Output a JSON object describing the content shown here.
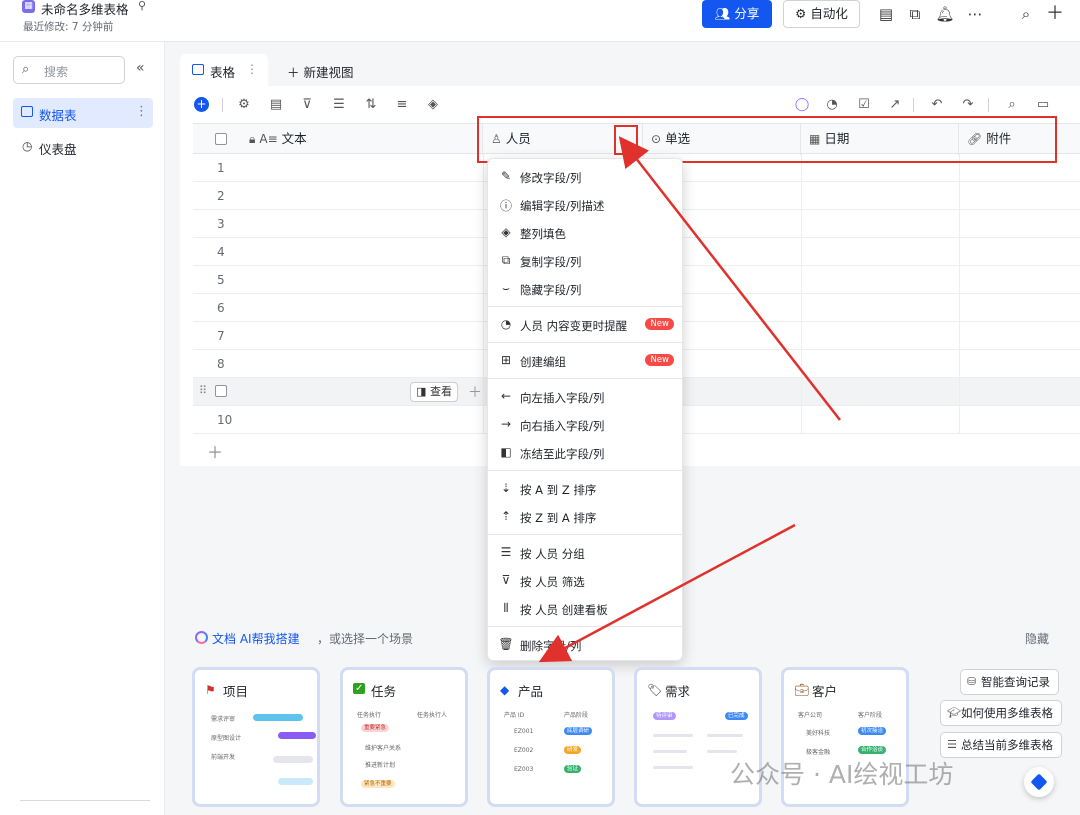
{
  "header": {
    "doc_title": "未命名多维表格",
    "last_modified": "最近修改: 7 分钟前",
    "share_label": "分享",
    "automation_label": "自动化"
  },
  "sidebar": {
    "search_placeholder": "搜索",
    "items": [
      {
        "label": "数据表",
        "active": true
      },
      {
        "label": "仪表盘",
        "active": false
      }
    ]
  },
  "views": {
    "active_tab": "表格",
    "new_view_label": "新建视图"
  },
  "table": {
    "columns": [
      {
        "label": "文本",
        "icon": "text-icon"
      },
      {
        "label": "人员",
        "icon": "person-icon"
      },
      {
        "label": "单选",
        "icon": "single-select-icon"
      },
      {
        "label": "日期",
        "icon": "calendar-icon"
      },
      {
        "label": "附件",
        "icon": "attachment-icon"
      }
    ],
    "row_numbers": [
      "1",
      "2",
      "3",
      "4",
      "5",
      "6",
      "7",
      "8",
      "",
      "10"
    ],
    "row_view_button": "查看"
  },
  "context_menu": {
    "items": [
      {
        "label": "修改字段/列",
        "icon": "pencil-icon"
      },
      {
        "label": "编辑字段/列描述",
        "icon": "info-icon"
      },
      {
        "label": "整列填色",
        "icon": "fill-icon"
      },
      {
        "label": "复制字段/列",
        "icon": "copy-icon"
      },
      {
        "label": "隐藏字段/列",
        "icon": "hide-icon"
      },
      {
        "label": "人员 内容变更时提醒",
        "icon": "reminder-icon",
        "badge": "New"
      },
      {
        "label": "创建编组",
        "icon": "group-icon",
        "badge": "New"
      },
      {
        "label": "向左插入字段/列",
        "icon": "arrow-left-icon"
      },
      {
        "label": "向右插入字段/列",
        "icon": "arrow-right-icon"
      },
      {
        "label": "冻结至此字段/列",
        "icon": "freeze-icon"
      },
      {
        "label": "按 A 到 Z 排序",
        "icon": "sort-asc-icon"
      },
      {
        "label": "按 Z 到 A 排序",
        "icon": "sort-desc-icon"
      },
      {
        "label": "按 人员 分组",
        "icon": "group-by-icon"
      },
      {
        "label": "按 人员 筛选",
        "icon": "filter-icon"
      },
      {
        "label": "按 人员 创建看板",
        "icon": "kanban-icon"
      },
      {
        "label": "删除字段/列",
        "icon": "trash-icon"
      }
    ]
  },
  "ai_banner": {
    "link": "文档 AI帮我搭建",
    "subtitle": "，或选择一个场景",
    "hide": "隐藏"
  },
  "scenarios": [
    {
      "title": "项目",
      "icon": "flag-icon"
    },
    {
      "title": "任务",
      "icon": "check-icon"
    },
    {
      "title": "产品",
      "icon": "diamond-icon"
    },
    {
      "title": "需求",
      "icon": "tag-icon"
    },
    {
      "title": "客户",
      "icon": "briefcase-icon"
    }
  ],
  "side_actions": [
    "智能查询记录",
    "如何使用多维表格",
    "总结当前多维表格"
  ],
  "preview_text": {
    "task_headers": [
      "任务执行",
      "任务执行人"
    ],
    "task_rows": [
      "维护客户关系",
      "推进新计划"
    ],
    "task_badges": [
      "重要紧急",
      "紧急不重要"
    ],
    "product_headers": [
      "产品 ID",
      "产品阶段"
    ],
    "product_rows": [
      "EZ001",
      "EZ002",
      "EZ003"
    ],
    "product_badges": [
      "底层调研",
      "研发",
      "验证"
    ],
    "project_rows": [
      "需求评审",
      "原型图设计",
      "前端开发"
    ],
    "req_badges": [
      "待评审",
      "已完成"
    ],
    "customer_headers": [
      "客户公司",
      "客户阶段"
    ],
    "customer_rows": [
      "美好科技",
      "极客金融"
    ],
    "customer_badges": [
      "初次接洽",
      "合作洽谈"
    ]
  },
  "watermark": "公众号 · AI绘视工坊",
  "colors": {
    "accent": "#1456f0",
    "highlight_red": "#e0312d",
    "badge_red": "#f54a45"
  }
}
